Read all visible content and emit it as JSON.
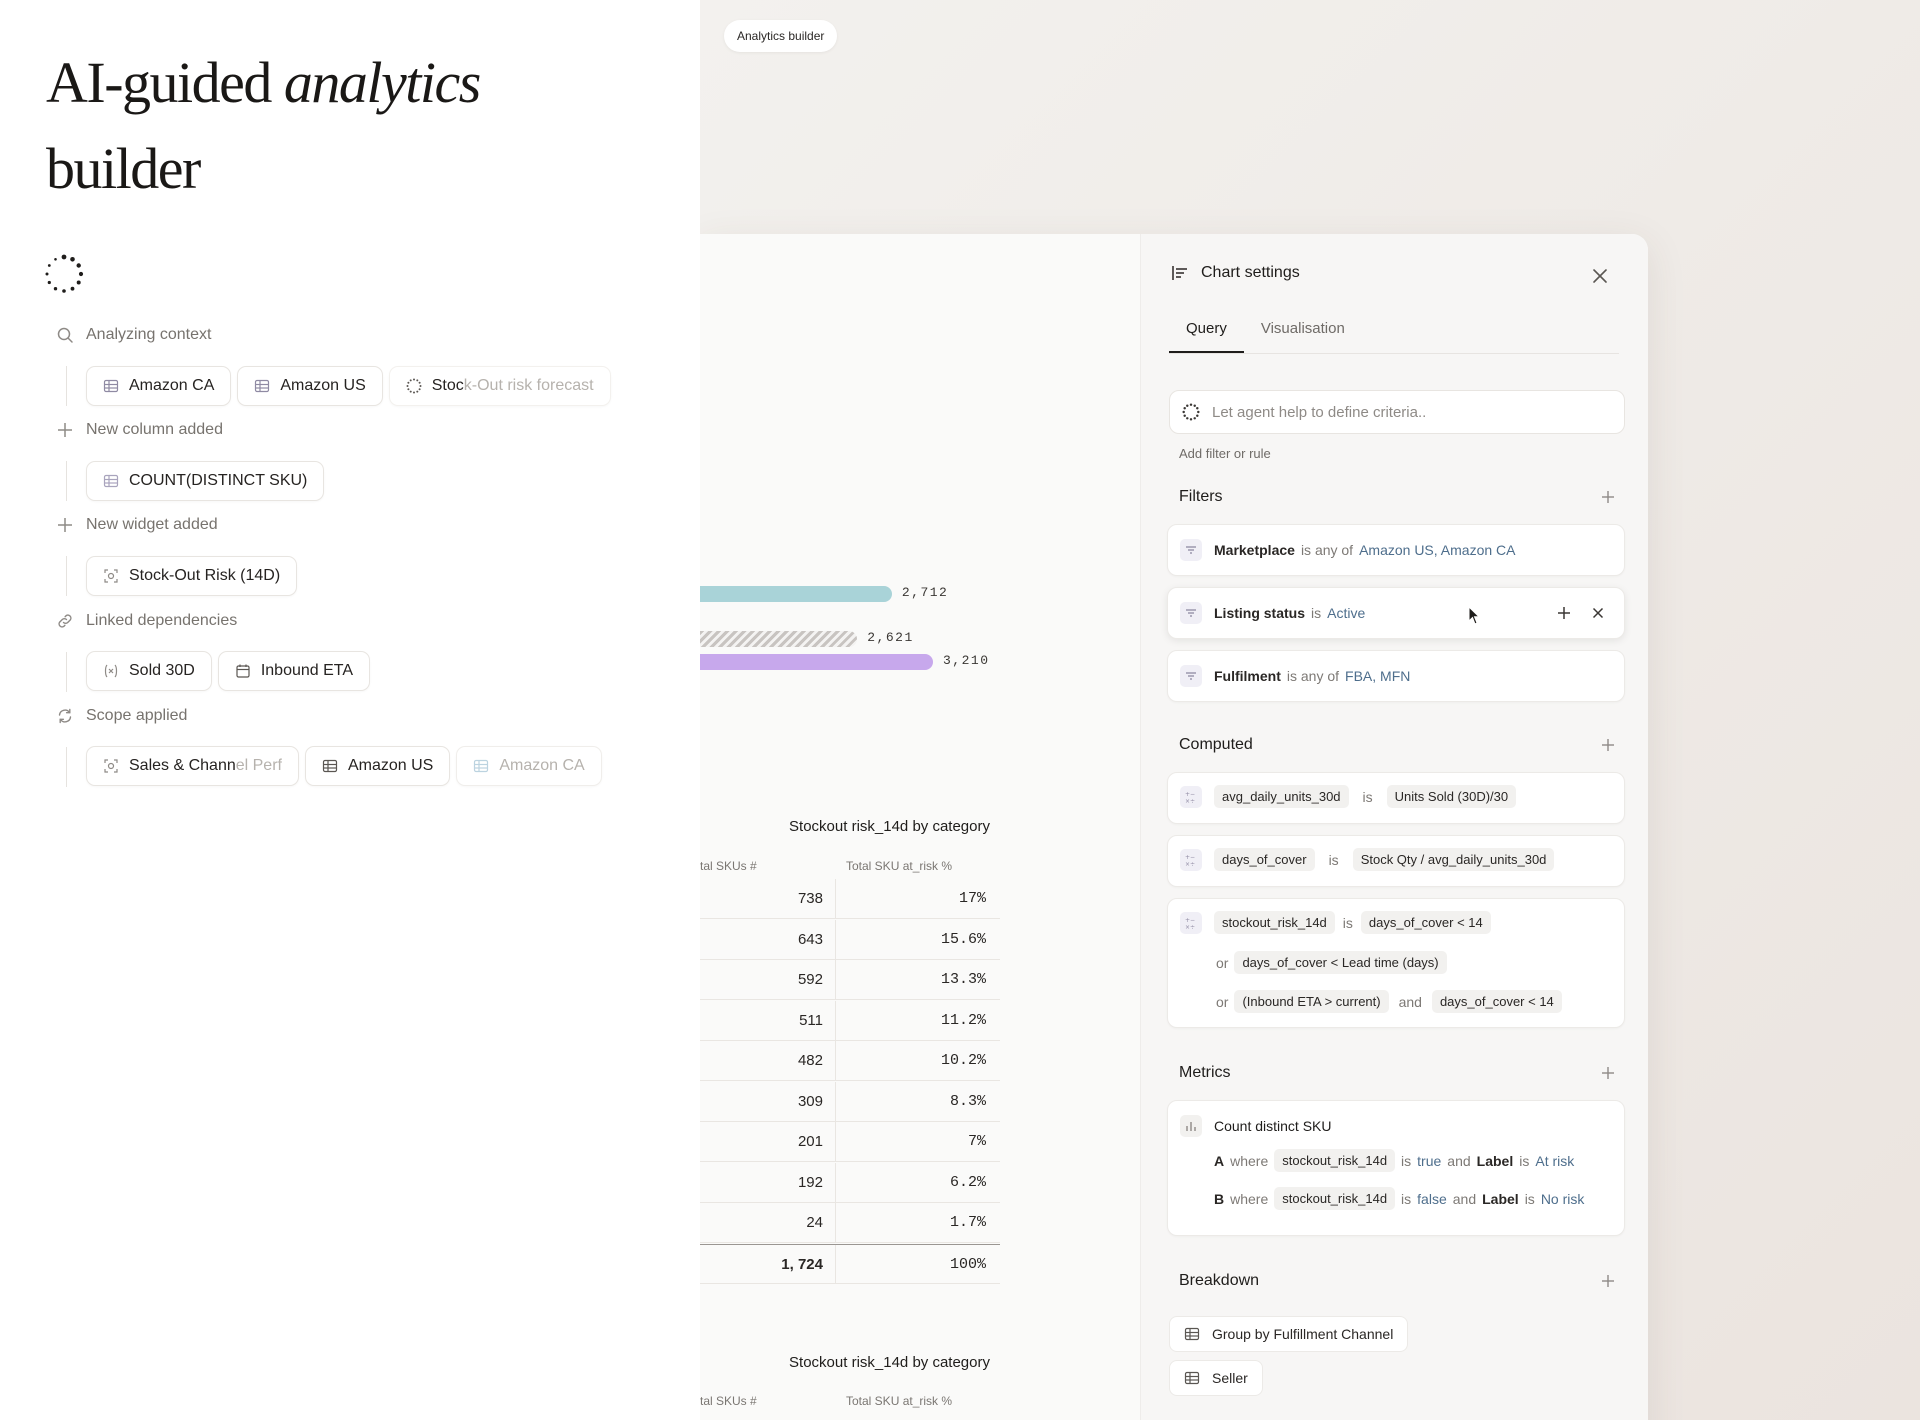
{
  "hero": {
    "line1_part1": "AI-guided ",
    "line1_italic": "analytics",
    "line2": "builder"
  },
  "steps": [
    {
      "label": "Analyzing context",
      "icon": "search-icon",
      "chips": [
        {
          "label": "Amazon CA",
          "icon": "table-icon"
        },
        {
          "label": "Amazon US",
          "icon": "table-icon"
        },
        {
          "label_main": "Stoc",
          "label_fade": "k-Out risk forecast",
          "icon": "spinner-icon"
        }
      ]
    },
    {
      "label": "New column added",
      "icon": "plus-icon",
      "chips": [
        {
          "label": "COUNT(DISTINCT SKU)",
          "icon": "table-icon"
        }
      ]
    },
    {
      "label": "New widget added",
      "icon": "plus-icon",
      "chips": [
        {
          "label": "Stock-Out Risk (14D)",
          "icon": "widget-icon"
        }
      ]
    },
    {
      "label": "Linked dependencies",
      "icon": "link-icon",
      "chips": [
        {
          "label": "Sold 30D",
          "icon": "variable-icon"
        },
        {
          "label": "Inbound ETA",
          "icon": "calendar-icon"
        }
      ]
    },
    {
      "label": "Scope applied",
      "icon": "refresh-icon",
      "chips": [
        {
          "label_main": "Sales & Chann",
          "label_fade": "el Perf",
          "icon": "widget-icon"
        },
        {
          "label": "Amazon US",
          "icon": "table-icon"
        },
        {
          "label": "Amazon CA",
          "icon": "table-icon"
        }
      ]
    }
  ],
  "breadcrumb": "Analytics builder",
  "chart_data": {
    "type": "bar",
    "orientation": "horizontal",
    "values": [
      2712,
      2621,
      3210
    ],
    "labels": [
      "2,712",
      "2,621",
      "3,210"
    ],
    "colors": [
      "#a9d3d8",
      "#d2ced6",
      "#c7a8ec"
    ]
  },
  "tables": [
    {
      "title": "Stockout risk_14d by category",
      "headers": [
        "tal SKUs #",
        "Total SKU at_risk %"
      ],
      "rows": [
        [
          "738",
          "17%"
        ],
        [
          "643",
          "15.6%"
        ],
        [
          "592",
          "13.3%"
        ],
        [
          "511",
          "11.2%"
        ],
        [
          "482",
          "10.2%"
        ],
        [
          "309",
          "8.3%"
        ],
        [
          "201",
          "7%"
        ],
        [
          "192",
          "6.2%"
        ],
        [
          "24",
          "1.7%"
        ]
      ],
      "total": [
        "1, 724",
        "100%"
      ]
    },
    {
      "title": "Stockout risk_14d by category",
      "headers": [
        "tal SKUs #",
        "Total SKU at_risk %"
      ]
    }
  ],
  "settings": {
    "title": "Chart settings",
    "tabs": [
      "Query",
      "Visualisation"
    ],
    "agent_placeholder": "Let agent help to define criteria..",
    "add_filter_label": "Add filter or rule",
    "sections": {
      "filters": "Filters",
      "computed": "Computed",
      "metrics": "Metrics",
      "breakdown": "Breakdown"
    },
    "filters": [
      {
        "field": "Marketplace",
        "op": "is any of",
        "value": "Amazon US, Amazon CA"
      },
      {
        "field": "Listing status",
        "op": "is",
        "value": "Active"
      },
      {
        "field": "Fulfilment",
        "op": "is any of",
        "value": "FBA, MFN"
      }
    ],
    "computed": [
      {
        "name": "avg_daily_units_30d",
        "op": "is",
        "expr": "Units Sold (30D)/30"
      },
      {
        "name": "days_of_cover",
        "op": "is",
        "expr": "Stock Qty / avg_daily_units_30d"
      },
      {
        "name": "stockout_risk_14d",
        "op": "is",
        "expr": "days_of_cover < 14",
        "or1_kw": "or",
        "or1": "days_of_cover < Lead time (days)",
        "or2_kw": "or",
        "or2_a": "(Inbound ETA > current)",
        "and_kw": "and",
        "or2_b": "days_of_cover < 14"
      }
    ],
    "metric": {
      "title": "Count distinct SKU",
      "rows": [
        {
          "letter": "A",
          "where": "where",
          "field": "stockout_risk_14d",
          "is": "is",
          "val": "true",
          "and": "and",
          "label": "Label",
          "is2": "is",
          "label_val": "At risk"
        },
        {
          "letter": "B",
          "where": "where",
          "field": "stockout_risk_14d",
          "is": "is",
          "val": "false",
          "and": "and",
          "label": "Label",
          "is2": "is",
          "label_val": "No risk"
        }
      ]
    },
    "breakdown": [
      "Group by Fulfillment Channel",
      "Seller"
    ]
  }
}
